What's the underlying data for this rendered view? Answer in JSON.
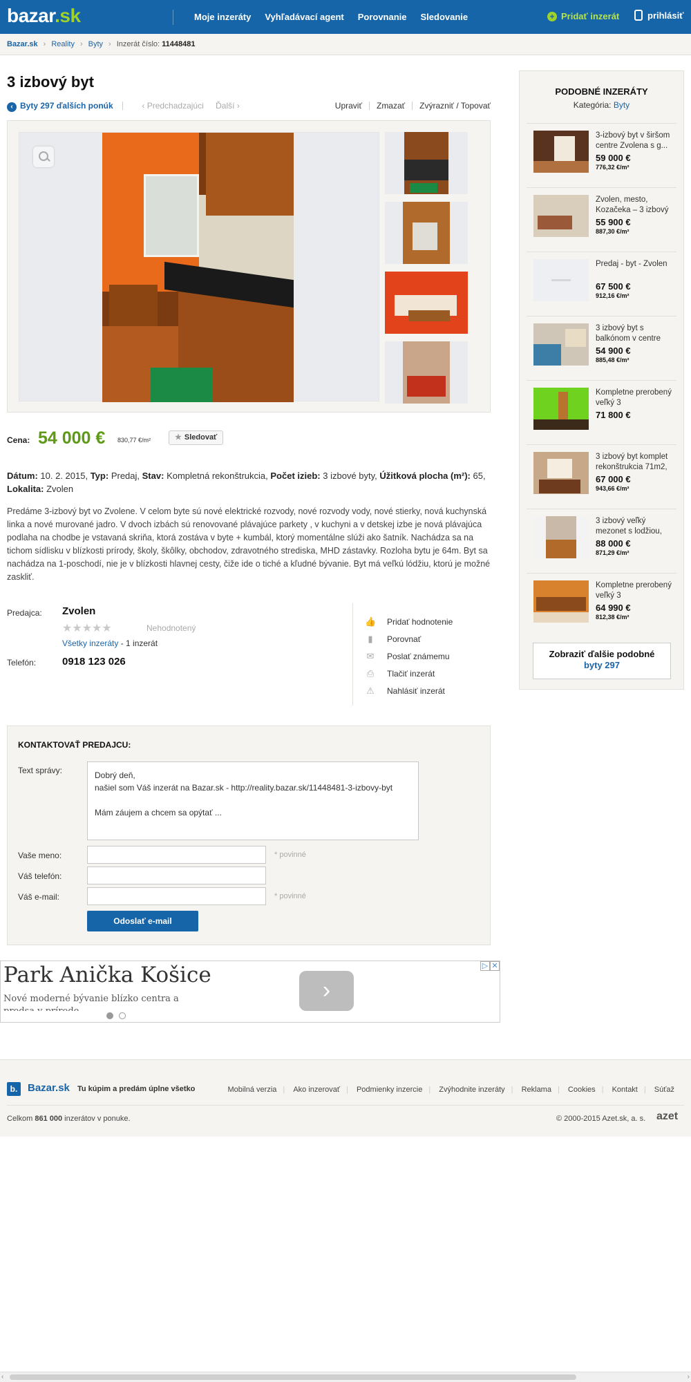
{
  "header": {
    "logo_main": "bazar",
    "logo_tld": ".sk",
    "nav": [
      "Moje inzeráty",
      "Vyhľadávací agent",
      "Porovnanie",
      "Sledovanie"
    ],
    "add_label": "Pridať inzerát",
    "login_label": "prihlásiť"
  },
  "breadcrumb": {
    "items": [
      "Bazar.sk",
      "Reality",
      "Byty"
    ],
    "ad_label": "Inzerát číslo:",
    "ad_number": "11448481"
  },
  "listing": {
    "title": "3 izbový byt",
    "back_label": "Byty 297 ďalších ponúk",
    "prev_label": "Predchadzajúci",
    "next_label": "Ďalší",
    "actions": [
      "Upraviť",
      "Zmazať",
      "Zvýrazniť / Topovať"
    ],
    "price_label": "Cena:",
    "price": "54 000 €",
    "price_per_m2": "830,77 €/m²",
    "follow_label": "Sledovať",
    "details": {
      "datum_label": "Dátum:",
      "datum": "10. 2. 2015,",
      "typ_label": "Typ:",
      "typ": "Predaj,",
      "stav_label": "Stav:",
      "stav": "Kompletná rekonštrukcia,",
      "izby_label": "Počet izieb:",
      "izby": "3 izbové byty,",
      "plocha_label": "Úžitková plocha (m²):",
      "plocha": "65,",
      "lokalita_label": "Lokalita:",
      "lokalita": "Zvolen"
    },
    "description": "Predáme 3-izbový byt vo Zvolene. V celom byte sú nové elektrické rozvody, nové rozvody vody, nové stierky, nová kuchynská linka a nové murované jadro. V dvoch izbách sú renovované plávajúce parkety , v kuchyni a v detskej izbe je nová plávajúca podlaha na chodbe je vstavaná skriňa, ktorá zostáva v byte + kumbál, ktorý momentálne slúži ako šatník. Nachádza sa na tichom sídlisku v blízkosti prírody, školy, škôlky, obchodov, zdravotného strediska, MHD zástavky. Rozloha bytu je 64m. Byt sa nachádza na 1-poschodí, nie je v blízkosti hlavnej cesty, čiže ide o tiché a kľudné bývanie. Byt má veľkú lódžiu, ktorú je možné zaskliť."
  },
  "seller": {
    "seller_label": "Predajca:",
    "name": "Zvolen",
    "rating_label": "Nehodnotený",
    "all_ads_link": "Všetky inzeráty",
    "all_ads_count": " - 1 inzerát",
    "phone_label": "Telefón:",
    "phone": "0918 123 026",
    "actions": [
      "Pridať hodnotenie",
      "Porovnať",
      "Poslať známemu",
      "Tlačiť inzerát",
      "Nahlásiť inzerát"
    ]
  },
  "contact": {
    "heading": "KONTAKTOVAŤ PREDAJCU:",
    "message_label": "Text správy:",
    "message_value": "Dobrý deň,\nnašiel som Váš inzerát na Bazar.sk - http://reality.bazar.sk/11448481-3-izbovy-byt\n\nMám záujem a chcem sa opýtať ...",
    "name_label": "Vaše meno:",
    "phone_label": "Váš telefón:",
    "email_label": "Váš e-mail:",
    "required": "* povinné",
    "send_label": "Odoslať e-mail"
  },
  "ad_banner": {
    "title": "Park Anička Košice",
    "subtitle": "Nové moderné bývanie blízko centra a predsa v prírode"
  },
  "footer": {
    "logo": "Bazar.sk",
    "logo_letter": "b.",
    "slogan": "Tu kúpim a predám úplne všetko",
    "links": [
      "Mobilná verzia",
      "Ako inzerovať",
      "Podmienky inzercie",
      "Zvýhodnite inzeráty",
      "Reklama",
      "Cookies",
      "Kontakt",
      "Súťaž"
    ],
    "total_prefix": "Celkom ",
    "total_count": "861 000",
    "total_suffix": " inzerátov v ponuke.",
    "copyright": "© 2000-2015 Azet.sk, a. s.",
    "azet_logo": "azet"
  },
  "sidebar": {
    "title": "PODOBNÉ INZERÁTY",
    "category_label": "Kategória:",
    "category": "Byty",
    "items": [
      {
        "title": "3-izbový byt v širšom centre Zvolena s g...",
        "price": "59 000 €",
        "ppm": "776,32 €/m²"
      },
      {
        "title": "Zvolen, mesto, Kozačeka – 3 izbový",
        "price": "55 900 €",
        "ppm": "887,30 €/m²"
      },
      {
        "title": "Predaj - byt - Zvolen",
        "price": "67 500 €",
        "ppm": "912,16 €/m²"
      },
      {
        "title": "3 izbový byt s balkónom v centre",
        "price": "54 900 €",
        "ppm": "885,48 €/m²"
      },
      {
        "title": "Kompletne prerobený veľký 3",
        "price": "71 800 €",
        "ppm": ""
      },
      {
        "title": "3 izbový byt komplet rekonštrukcia 71m2,",
        "price": "67 000 €",
        "ppm": "943,66 €/m²"
      },
      {
        "title": "3 izbový veľký mezonet s lodžiou,",
        "price": "88 000 €",
        "ppm": "871,29 €/m²"
      },
      {
        "title": "Kompletne prerobený veľký 3",
        "price": "64 990 €",
        "ppm": "812,38 €/m²"
      }
    ],
    "more_label": "Zobraziť ďalšie podobné",
    "more_link": "byty 297"
  },
  "colors": {
    "brand_blue": "#1565a8",
    "price_green": "#5e9a16",
    "panel_bg": "#f5f4f0"
  }
}
